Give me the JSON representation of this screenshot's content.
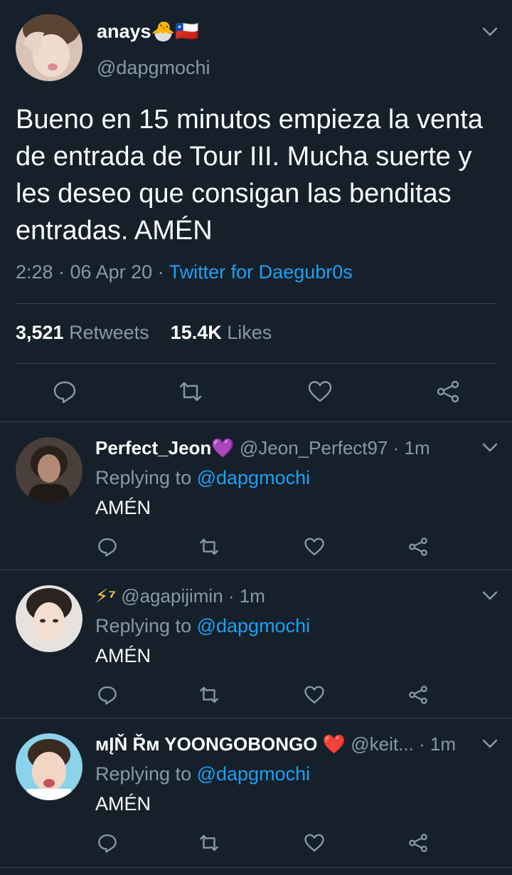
{
  "main_tweet": {
    "display_name": "anays🐣🇨🇱",
    "handle": "@dapgmochi",
    "text": "Bueno en 15 minutos empieza la venta de entrada de Tour III. Mucha suerte y les deseo que consigan las benditas entradas. AMÉN",
    "time": "2:28 · 06 Apr 20 · ",
    "source": "Twitter for Daegubr0s",
    "retweets_count": "3,521",
    "retweets_label": "Retweets",
    "likes_count": "15.4K",
    "likes_label": "Likes"
  },
  "replies": [
    {
      "display_name": "Perfect_Jeon💜",
      "meta": " @Jeon_Perfect97 · 1m",
      "replying_label": "Replying to ",
      "replying_handle": "@dapgmochi",
      "text": "AMÉN"
    },
    {
      "display_name": "⚡⁷",
      "meta": " @agapijimin · 1m",
      "replying_label": "Replying to ",
      "replying_handle": "@dapgmochi",
      "text": "AMÉN"
    },
    {
      "display_name": "ᴍĮŇ Řᴍ YOONGOBONGO ❤️",
      "meta": " @keit... · 1m",
      "replying_label": "Replying to ",
      "replying_handle": "@dapgmochi",
      "text": "AMÉN"
    }
  ],
  "icons": {
    "reply": "reply-icon",
    "retweet": "retweet-icon",
    "like": "heart-icon",
    "share": "share-icon",
    "menu": "chevron-down-icon"
  },
  "colors": {
    "background": "#15202b",
    "secondary_text": "#8899a6",
    "link": "#1da1f2",
    "divider": "#38444d"
  }
}
